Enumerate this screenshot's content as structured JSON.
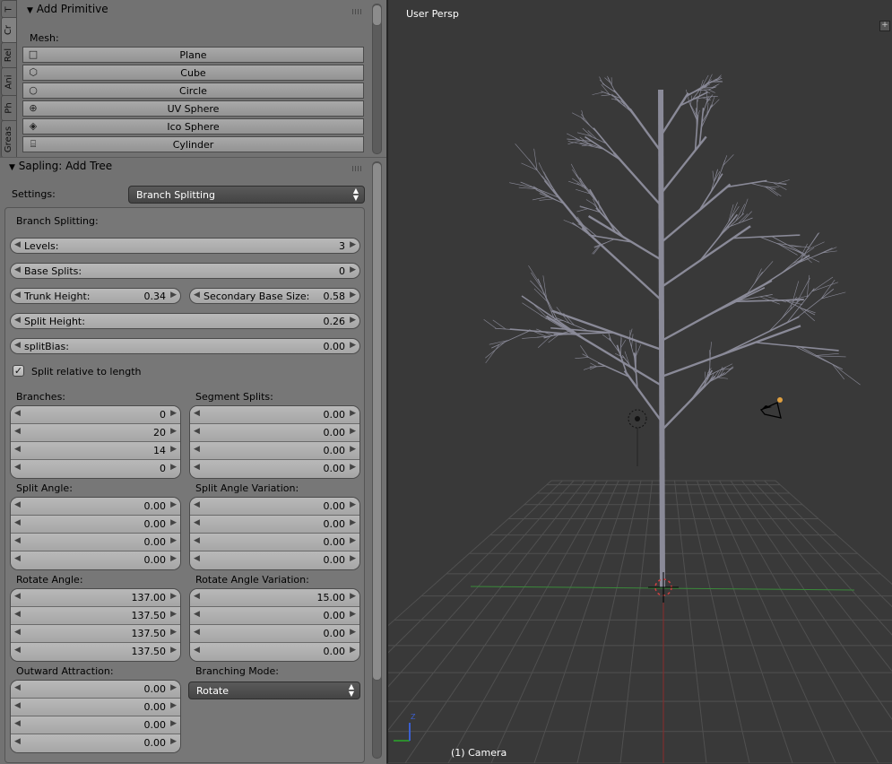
{
  "tabs": [
    "T",
    "Cr",
    "Rel",
    "Ani",
    "Ph",
    "Greas"
  ],
  "add_primitive": {
    "title": "Add Primitive",
    "mesh_label": "Mesh:",
    "items": [
      {
        "label": "Plane",
        "icon": "plane-icon"
      },
      {
        "label": "Cube",
        "icon": "cube-icon"
      },
      {
        "label": "Circle",
        "icon": "circle-icon"
      },
      {
        "label": "UV Sphere",
        "icon": "uv-sphere-icon"
      },
      {
        "label": "Ico Sphere",
        "icon": "ico-sphere-icon"
      },
      {
        "label": "Cylinder",
        "icon": "cylinder-icon"
      }
    ]
  },
  "sapling": {
    "title": "Sapling: Add Tree",
    "settings_label": "Settings:",
    "settings_value": "Branch Splitting",
    "section_title": "Branch Splitting:",
    "levels": {
      "label": "Levels:",
      "value": "3"
    },
    "base_splits": {
      "label": "Base Splits:",
      "value": "0"
    },
    "trunk_height": {
      "label": "Trunk Height:",
      "value": "0.34"
    },
    "secondary_base_size": {
      "label": "Secondary Base Size:",
      "value": "0.58"
    },
    "split_height": {
      "label": "Split Height:",
      "value": "0.26"
    },
    "split_bias": {
      "label": "splitBias:",
      "value": "0.00"
    },
    "split_relative": {
      "label": "Split relative to length",
      "checked": true
    },
    "branches": {
      "label": "Branches:",
      "values": [
        "0",
        "20",
        "14",
        "0"
      ]
    },
    "segment_splits": {
      "label": "Segment Splits:",
      "values": [
        "0.00",
        "0.00",
        "0.00",
        "0.00"
      ]
    },
    "split_angle": {
      "label": "Split Angle:",
      "values": [
        "0.00",
        "0.00",
        "0.00",
        "0.00"
      ]
    },
    "split_angle_variation": {
      "label": "Split Angle Variation:",
      "values": [
        "0.00",
        "0.00",
        "0.00",
        "0.00"
      ]
    },
    "rotate_angle": {
      "label": "Rotate Angle:",
      "values": [
        "137.00",
        "137.50",
        "137.50",
        "137.50"
      ]
    },
    "rotate_angle_variation": {
      "label": "Rotate Angle Variation:",
      "values": [
        "15.00",
        "0.00",
        "0.00",
        "0.00"
      ]
    },
    "outward_attraction": {
      "label": "Outward Attraction:",
      "values": [
        "0.00",
        "0.00",
        "0.00",
        "0.00"
      ]
    },
    "branching_mode": {
      "label": "Branching Mode:",
      "value": "Rotate"
    }
  },
  "viewport": {
    "view_name": "User Persp",
    "object_label": "(1) Camera",
    "axis_z": "Z",
    "colors": {
      "background": "#393939",
      "grid": "#505050",
      "x_axis": "#3a8a3a",
      "y_axis": "#8a2a2a",
      "tree": "#8a8a98"
    }
  }
}
